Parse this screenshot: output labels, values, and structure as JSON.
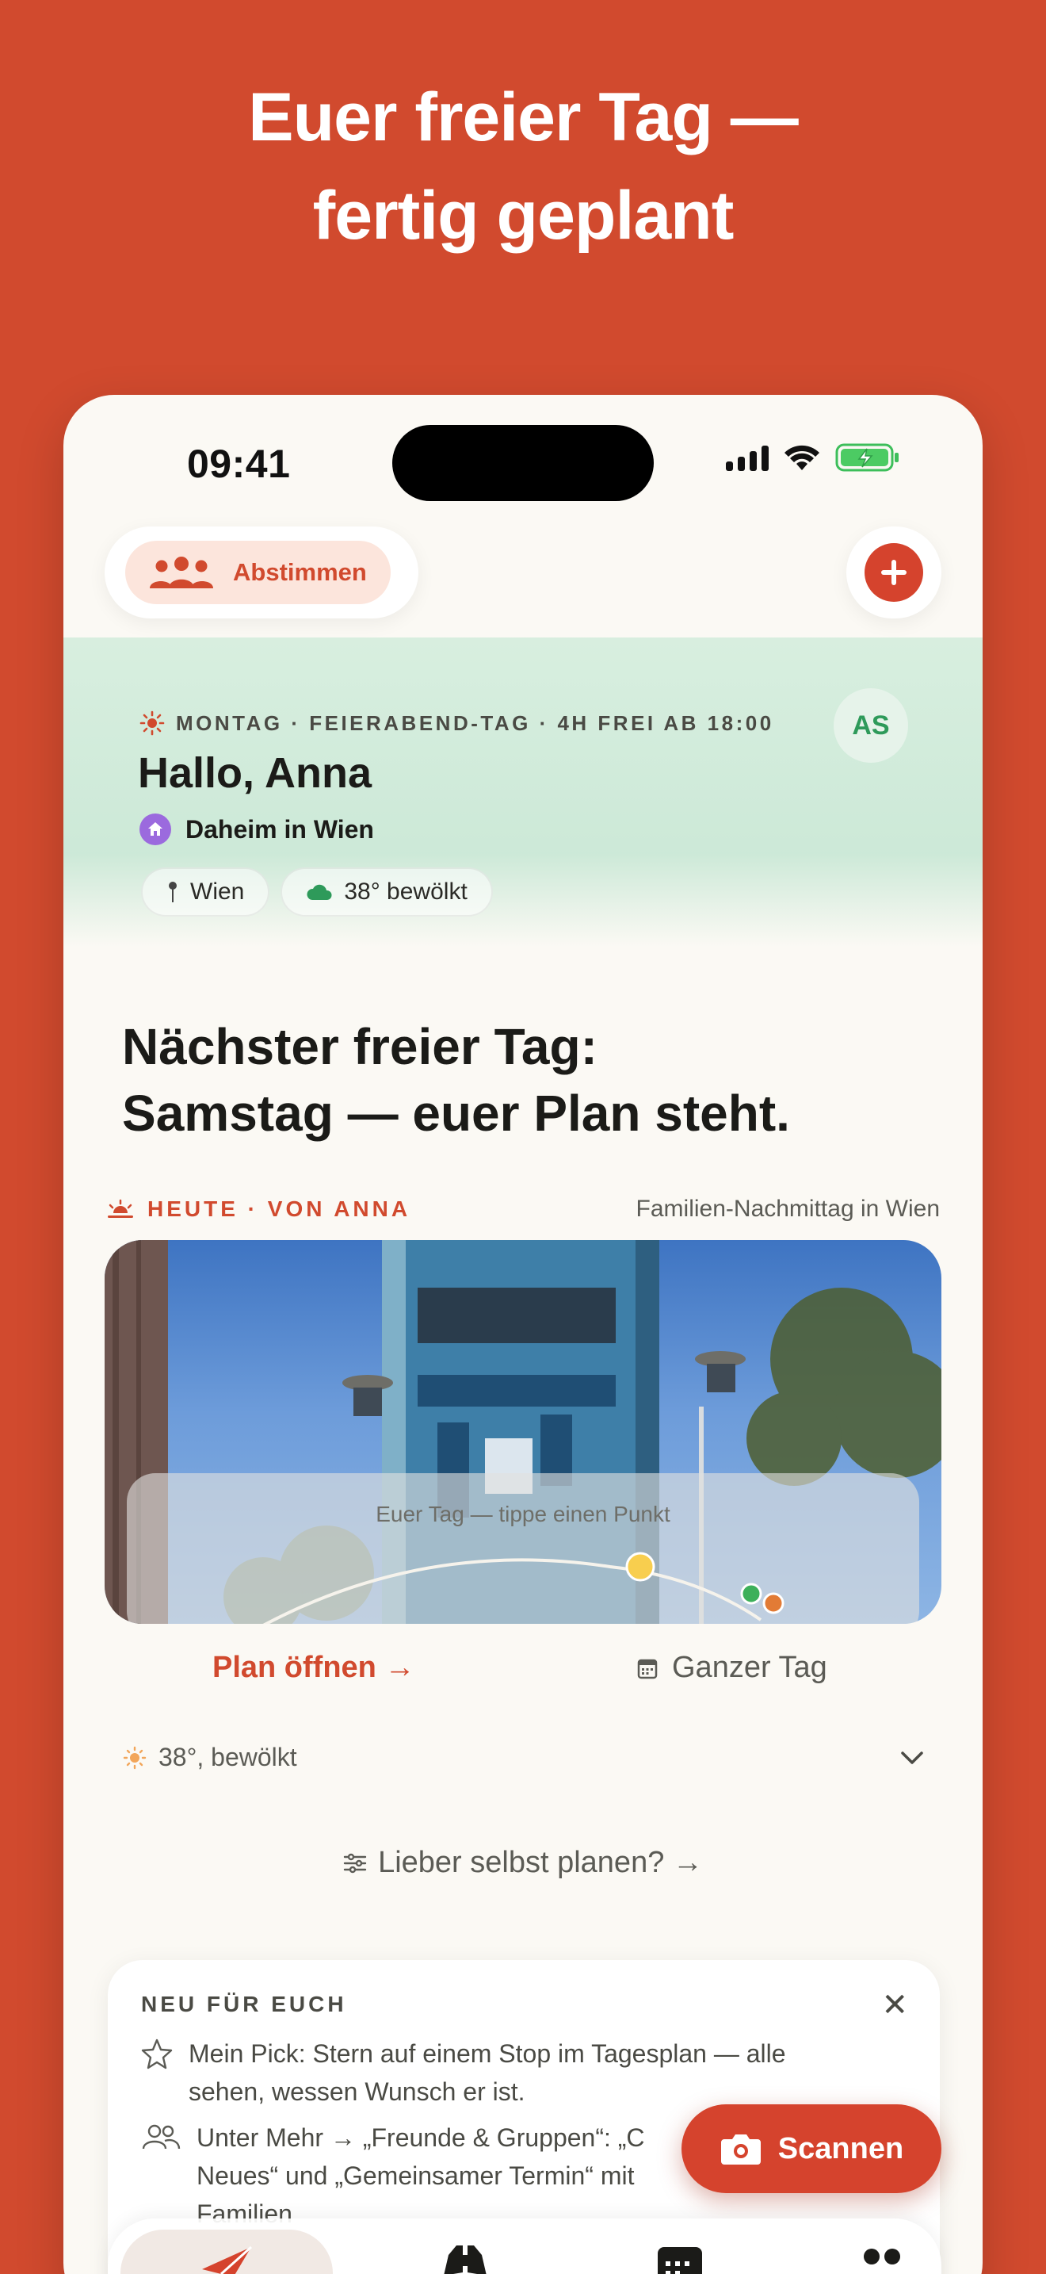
{
  "headline": {
    "line1": "Euer freier Tag —",
    "line2": "fertig geplant"
  },
  "status": {
    "time": "09:41"
  },
  "top_bar": {
    "vote_label": "Abstimmen",
    "add_icon": "plus-icon"
  },
  "greeting": {
    "meta": "MONTAG · FEIERABEND-TAG · 4H FREI AB 18:00",
    "title": "Hallo, Anna",
    "home": "Daheim in Wien",
    "avatar_initials": "AS",
    "chips": {
      "location": "Wien",
      "weather": "38° bewölkt"
    }
  },
  "next_day": {
    "line1": "Nächster freier Tag:",
    "line2": "Samstag — euer Plan steht."
  },
  "today": {
    "label": "HEUTE · VON ANNA",
    "title": "Familien-Nachmittag in Wien"
  },
  "photo": {
    "route_label": "Euer Tag — tippe einen Punkt"
  },
  "actions": {
    "plan_open": "Plan öffnen →",
    "whole_day": "Ganzer Tag"
  },
  "weather": {
    "text": "38°, bewölkt"
  },
  "self_plan": {
    "label": "Lieber selbst planen? →"
  },
  "news": {
    "heading": "NEU FÜR EUCH",
    "items": [
      {
        "line1": "Mein Pick: Stern auf einem Stop im Tagesplan — alle",
        "line2": "sehen, wessen Wunsch er ist."
      },
      {
        "line1": "Unter Mehr → „Freunde & Gruppen“: „C",
        "line2": "Neues“ und „Gemeinsamer Termin“ mit ",
        "line3": "Familien"
      }
    ]
  },
  "scan": {
    "label": "Scannen"
  },
  "colors": {
    "brand": "#D14A2E",
    "greeting_bg": "#CDE8D6",
    "avatar_text": "#2E9A5A"
  }
}
